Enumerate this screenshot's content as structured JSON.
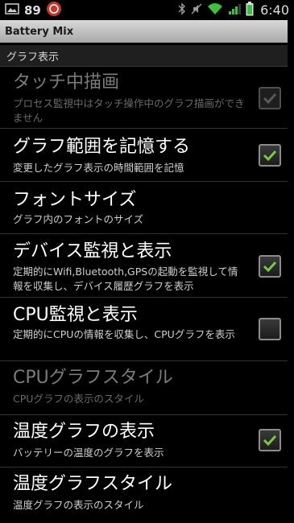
{
  "status_bar": {
    "notification_count": "89",
    "time": "6:40",
    "icons": [
      "image-icon",
      "app-notification-icon",
      "bluetooth-icon",
      "mute-icon",
      "wifi-icon",
      "signal-icon",
      "battery-icon"
    ]
  },
  "app": {
    "title": "Battery Mix"
  },
  "category": {
    "label": "グラフ表示"
  },
  "preferences": [
    {
      "title": "タッチ中描画",
      "summary": "プロセス監視中はタッチ操作中のグラフ描画ができません",
      "checked": true,
      "enabled": false
    },
    {
      "title": "グラフ範囲を記憶する",
      "summary": "変更したグラフ表示の時間範囲を記憶",
      "checked": true,
      "enabled": true
    },
    {
      "title": "フォントサイズ",
      "summary": "グラフ内のフォントのサイズ",
      "enabled": true
    },
    {
      "title": "デバイス監視と表示",
      "summary": "定期的にWifi,Bluetooth,GPSの起動を監視して情報を収集し、デバイス履歴グラフを表示",
      "checked": true,
      "enabled": true
    },
    {
      "title": "CPU監視と表示",
      "summary": "定期的にCPUの情報を収集し、CPUグラフを表示",
      "checked": false,
      "enabled": true
    },
    {
      "title": "CPUグラフスタイル",
      "summary": "CPUグラフの表示のスタイル",
      "enabled": false
    },
    {
      "title": "温度グラフの表示",
      "summary": "バッテリーの温度のグラフを表示",
      "checked": true,
      "enabled": true
    },
    {
      "title": "温度グラフスタイル",
      "summary": "温度グラフの表示のスタイル",
      "enabled": true
    }
  ],
  "colors": {
    "check_green": "#7ac943",
    "title_bar": "#c4c4c4",
    "disabled_text": "#7b7b7b"
  }
}
